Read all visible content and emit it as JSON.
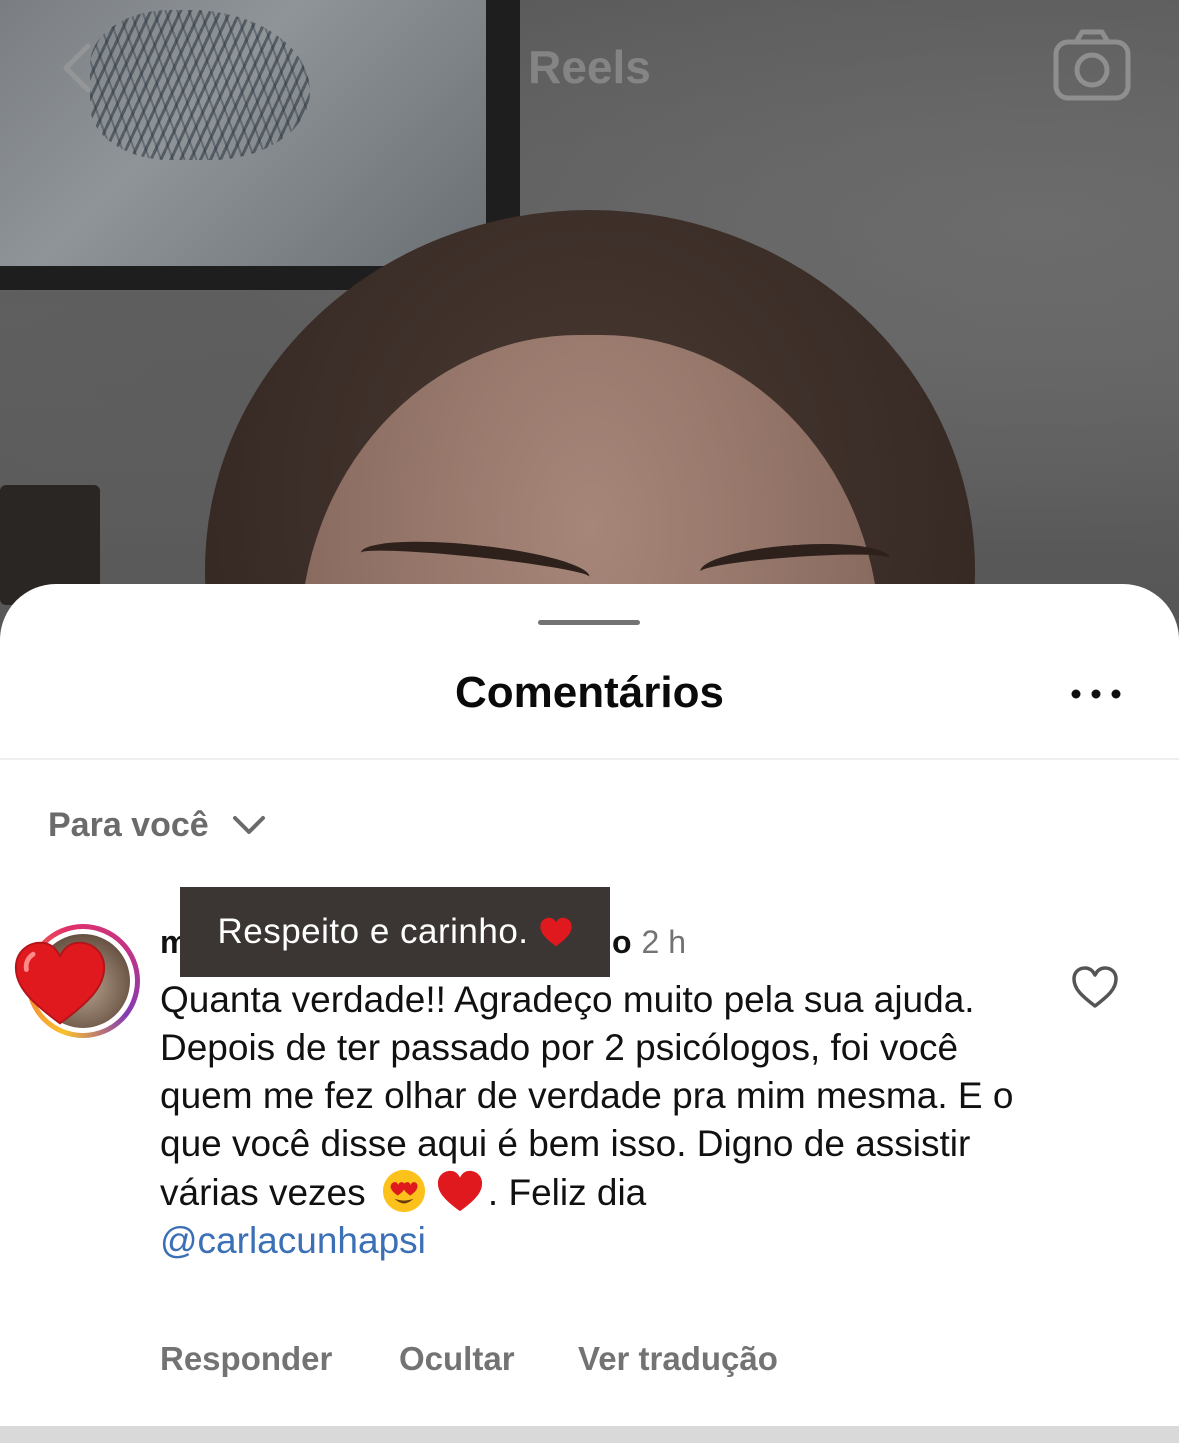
{
  "header": {
    "title": "Reels",
    "back_icon": "chevron-left-icon",
    "camera_icon": "camera-icon"
  },
  "sheet": {
    "title": "Comentários",
    "more_icon": "more-horizontal-icon",
    "sort": {
      "label": "Para você",
      "icon": "chevron-down-icon"
    }
  },
  "comment": {
    "username_start": "m",
    "username_end": "o",
    "timestamp": "2 h",
    "sticker_text": "Respeito e carinho.",
    "text_main": "Quanta verdade!! Agradeço muito pela sua ajuda. Depois de ter passado por 2 psicólogos, foi você quem me fez olhar de verdade pra mim mesma. E o que você disse aqui é bem isso. Digno de assistir várias vezes",
    "text_after_emoji": ". Feliz dia",
    "mention": "@carlacunhapsi",
    "actions": {
      "reply": "Responder",
      "hide": "Ocultar",
      "translate": "Ver tradução"
    }
  },
  "colors": {
    "mention": "#3b6fb6",
    "secondary_text": "#737373",
    "sticker_bg": "#3b3633",
    "heart_red": "#e0191f"
  }
}
